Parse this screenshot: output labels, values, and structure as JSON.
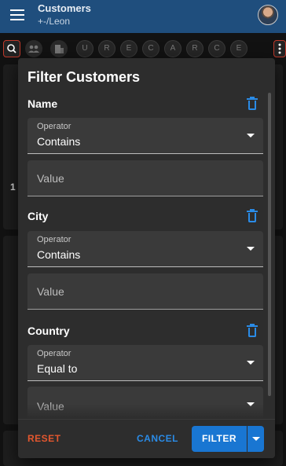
{
  "appbar": {
    "title": "Customers",
    "subtitle": "+-/Leon"
  },
  "toolbar": {
    "letters": [
      "U",
      "R",
      "E",
      "C",
      "A",
      "R",
      "C",
      "E"
    ]
  },
  "background": {
    "row_number": "1"
  },
  "dialog": {
    "title": "Filter Customers",
    "sections": [
      {
        "label": "Name",
        "operator_label": "Operator",
        "operator_value": "Contains",
        "value_placeholder": "Value"
      },
      {
        "label": "City",
        "operator_label": "Operator",
        "operator_value": "Contains",
        "value_placeholder": "Value"
      },
      {
        "label": "Country",
        "operator_label": "Operator",
        "operator_value": "Equal to",
        "value_placeholder": "Value"
      }
    ],
    "footer": {
      "reset": "RESET",
      "cancel": "CANCEL",
      "filter": "FILTER"
    }
  },
  "colors": {
    "appbar": "#1f4e7d",
    "accent": "#1976d2",
    "reset": "#e4572e",
    "dialog_bg": "#2d2d2d",
    "field_bg": "#3a3a3a"
  },
  "icons": [
    "menu-icon",
    "avatar",
    "search-icon",
    "group-icon",
    "building-icon",
    "trash-icon",
    "chevron-down-icon"
  ]
}
